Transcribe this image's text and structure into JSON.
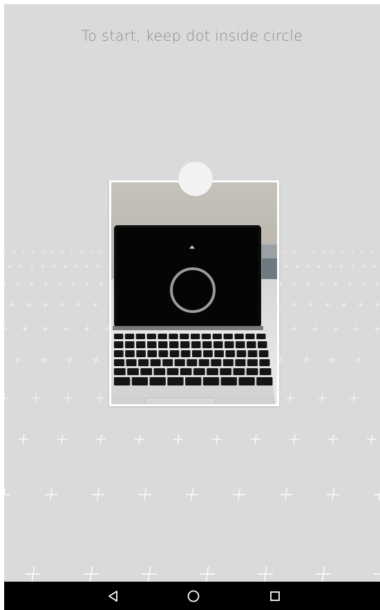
{
  "instruction": {
    "text": "To start, keep dot inside circle"
  },
  "capture": {
    "preview_alt": "camera preview of laptop",
    "target_dot_color": "#f2f2f2",
    "ring_color": "#9a9a9a"
  },
  "nav_bar": {
    "back_icon": "triangle-back-icon",
    "home_icon": "circle-home-icon",
    "recents_icon": "square-recents-icon"
  },
  "colors": {
    "background": "#dadada",
    "instruction_text": "#8c8c8c",
    "nav_bar": "#000000",
    "grid_marks": "#ffffff"
  }
}
